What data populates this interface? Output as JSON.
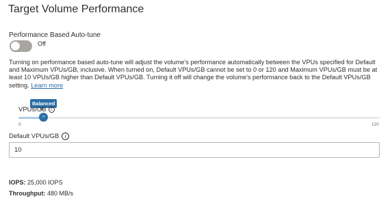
{
  "title": "Target Volume Performance",
  "auto_tune": {
    "label": "Performance Based Auto-tune",
    "state_text": "Off",
    "enabled": false
  },
  "description": {
    "text": "Turning on performance based auto-tune will adjust the volume's performance automatically between the VPUs specified for Default and Maximum VPUs/GB, inclusive. When turned on, Default VPUs/GB cannot be set to 0 or 120 and Maximum VPUs/GB must be at least 10 VPUs/GB higher than Default VPUs/GB. Turning it off will change the volume's performance back to the Default VPUs/GB setting.",
    "link_text": "Learn more"
  },
  "slider": {
    "label": "VPUs/GB",
    "tooltip": "Balanced",
    "min_label": "0",
    "max_label": "120",
    "value": 10,
    "thumb_icon": "chevrons-left-right-icon"
  },
  "default_vpus": {
    "label": "Default VPUs/GB",
    "value": "10"
  },
  "metrics": {
    "iops_label": "IOPS:",
    "iops_value": "25,000 IOPS",
    "throughput_label": "Throughput:",
    "throughput_value": "480 MB/s"
  },
  "colors": {
    "accent": "#2b6ea6",
    "link": "#2c6da7",
    "toggle_off": "#a9a6a2",
    "text": "#312d2a"
  }
}
